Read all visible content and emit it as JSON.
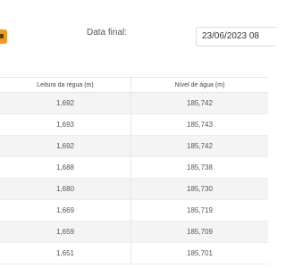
{
  "filters": {
    "date_final_label": "Data final:",
    "date_final_value": "23/06/2023 08"
  },
  "table": {
    "headers": [
      "Leitura da régua (m)",
      "Nível de água (m)"
    ],
    "rows": [
      [
        "1,692",
        "185,742"
      ],
      [
        "1,693",
        "185,743"
      ],
      [
        "1,692",
        "185,742"
      ],
      [
        "1,688",
        "185,738"
      ],
      [
        "1,680",
        "185,730"
      ],
      [
        "1,669",
        "185,719"
      ],
      [
        "1,659",
        "185,709"
      ],
      [
        "1,651",
        "185,701"
      ]
    ]
  },
  "colors": {
    "accent": "#f29a1f",
    "row_alt": "#f4f4f4",
    "border": "#e6e6e6"
  }
}
